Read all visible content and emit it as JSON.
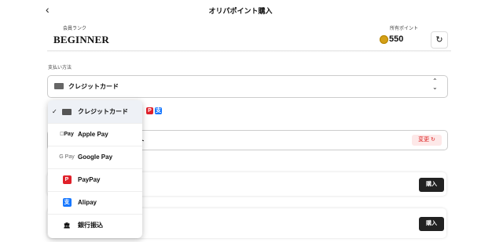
{
  "header": {
    "title": "オリパポイント購入",
    "back_icon": "chevron-left-icon"
  },
  "rank": {
    "label": "会員ランク",
    "name": "BEGINNER"
  },
  "points": {
    "label": "所有ポイント",
    "value": "550",
    "coin_color": "#d4a017"
  },
  "payment": {
    "label": "支払い方法",
    "selected": "クレジットカード"
  },
  "dropdown": {
    "options": [
      {
        "label": "クレジットカード",
        "icon": "credit-card-icon",
        "selected": true
      },
      {
        "label": "Apple Pay",
        "icon": "apple-pay-icon",
        "icon_text": "Pay"
      },
      {
        "label": "Google Pay",
        "icon": "google-pay-icon",
        "icon_text": "G Pay"
      },
      {
        "label": "PayPay",
        "icon": "paypay-icon"
      },
      {
        "label": "Alipay",
        "icon": "alipay-icon"
      },
      {
        "label": "銀行振込",
        "icon": "bank-icon"
      }
    ]
  },
  "card2": {
    "text": "ト",
    "change_label": "変更"
  },
  "rows": [
    {
      "buy_label": "購入"
    },
    {
      "buy_label": "購入"
    }
  ],
  "colors": {
    "paypay": "#e0202a",
    "alipay": "#1677ff",
    "change": "#d22222"
  }
}
